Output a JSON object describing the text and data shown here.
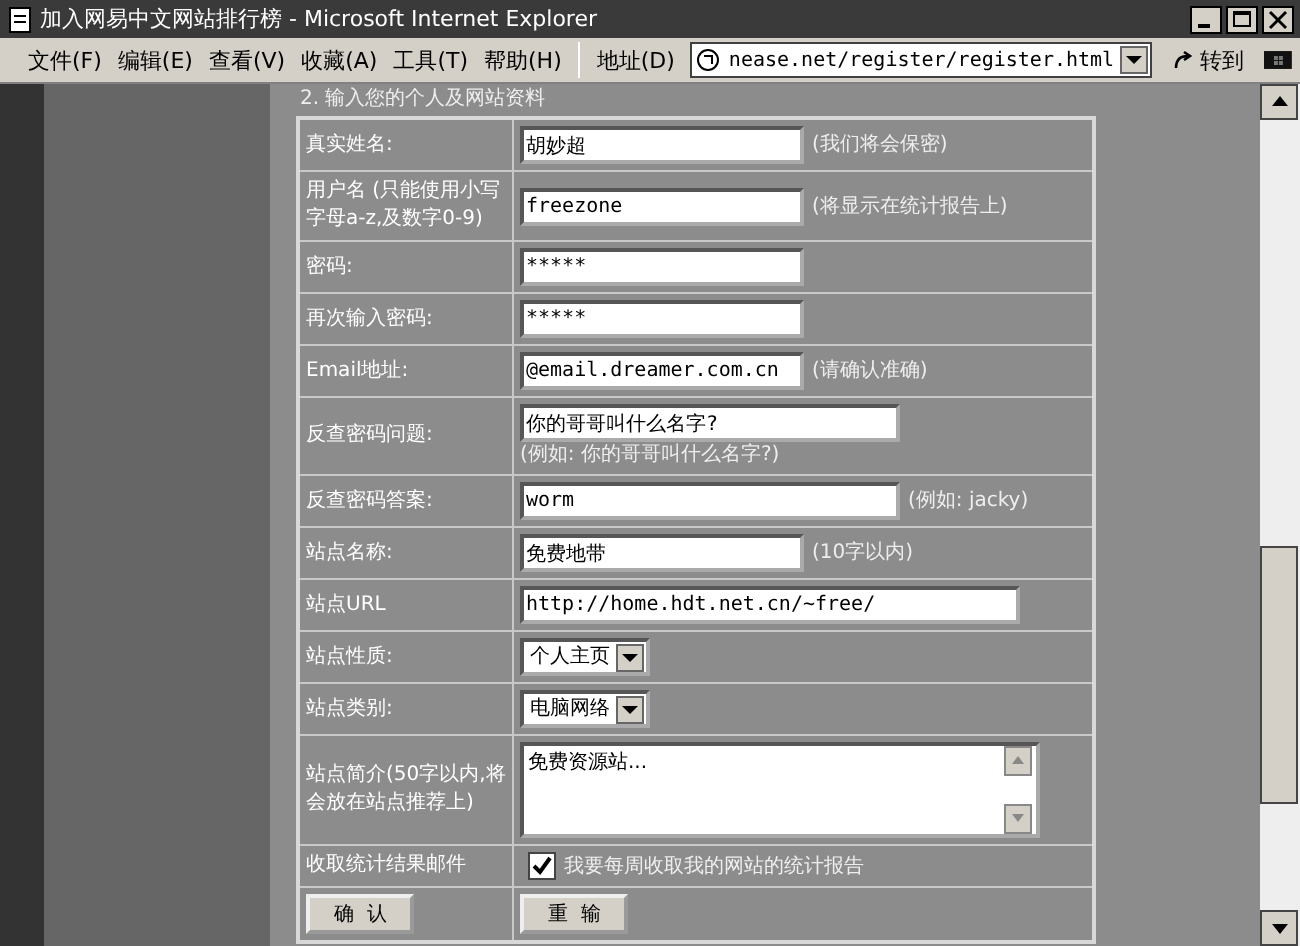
{
  "window": {
    "title": "加入网易中文网站排行榜 - Microsoft Internet Explorer"
  },
  "menu": [
    "文件(F)",
    "编辑(E)",
    "查看(V)",
    "收藏(A)",
    "工具(T)",
    "帮助(H)"
  ],
  "address": {
    "label": "地址(D)",
    "value": "nease.net/register/register.html",
    "go": "转到"
  },
  "section_heading": "2. 输入您的个人及网站资料",
  "rows": [
    {
      "label": "真实姓名:",
      "kind": "text",
      "value": "胡妙超",
      "note": "(我们将会保密)"
    },
    {
      "label": "用户名  (只能使用小写字母a-z,及数字0-9)",
      "kind": "text",
      "value": "freezone",
      "note": "(将显示在统计报告上)"
    },
    {
      "label": "密码:",
      "kind": "text",
      "value": "*****"
    },
    {
      "label": "再次输入密码:",
      "kind": "text",
      "value": "*****"
    },
    {
      "label": "Email地址:",
      "kind": "text",
      "value": "@email.dreamer.com.cn",
      "note": "(请确认准确)"
    },
    {
      "label": "反查密码问题:",
      "kind": "text",
      "value": "你的哥哥叫什么名字?",
      "note": "(例如: 你的哥哥叫什么名字?)"
    },
    {
      "label": "反查密码答案:",
      "kind": "text",
      "value": "worm",
      "note": "(例如: jacky)"
    },
    {
      "label": "站点名称:",
      "kind": "text",
      "value": "免费地带",
      "note": "(10字以内)"
    },
    {
      "label": "站点URL",
      "kind": "text",
      "value": "http://home.hdt.net.cn/~free/"
    },
    {
      "label": "站点性质:",
      "kind": "select",
      "value": "个人主页"
    },
    {
      "label": "站点类别:",
      "kind": "select",
      "value": "电脑网络"
    },
    {
      "label": "站点简介(50字以内,将会放在站点推荐上)",
      "kind": "textarea",
      "value": "免费资源站..."
    },
    {
      "label": "收取统计结果邮件",
      "kind": "checkbox",
      "checked": true,
      "value": "我要每周收取我的网站的统计报告"
    }
  ],
  "buttons": [
    "确  认",
    "重  输"
  ]
}
